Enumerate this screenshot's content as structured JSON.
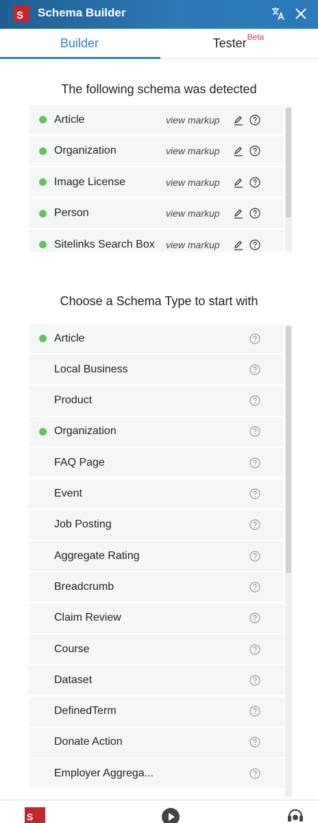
{
  "app": {
    "logo_letter": "S",
    "title": "Schema Builder"
  },
  "tabs": {
    "builder": "Builder",
    "tester": "Tester",
    "tester_badge": "Beta"
  },
  "detected": {
    "heading": "The following schema was detected",
    "items": [
      {
        "label": "Article",
        "action": "view markup",
        "active": true
      },
      {
        "label": "Organization",
        "action": "view markup",
        "active": true
      },
      {
        "label": "Image License",
        "action": "view markup",
        "active": true
      },
      {
        "label": "Person",
        "action": "view markup",
        "active": true
      },
      {
        "label": "Sitelinks Search Box",
        "action": "view markup",
        "active": true
      }
    ]
  },
  "types": {
    "heading": "Choose a Schema Type to start with",
    "items": [
      {
        "label": "Article",
        "active": true
      },
      {
        "label": "Local Business",
        "active": false
      },
      {
        "label": "Product",
        "active": false
      },
      {
        "label": "Organization",
        "active": true
      },
      {
        "label": "FAQ Page",
        "active": false
      },
      {
        "label": "Event",
        "active": false
      },
      {
        "label": "Job Posting",
        "active": false
      },
      {
        "label": "Aggregate Rating",
        "active": false
      },
      {
        "label": "Breadcrumb",
        "active": false
      },
      {
        "label": "Claim Review",
        "active": false
      },
      {
        "label": "Course",
        "active": false
      },
      {
        "label": "Dataset",
        "active": false
      },
      {
        "label": "DefinedTerm",
        "active": false
      },
      {
        "label": "Donate Action",
        "active": false
      },
      {
        "label": "Employer Aggrega...",
        "active": false
      }
    ]
  },
  "footer": {
    "logo_letter": "S"
  },
  "colors": {
    "header": "#2a72ad",
    "accent": "#2f80c1",
    "active_dot": "#62c35b",
    "badge": "#d23a3a",
    "logo": "#c4262e"
  },
  "icons": [
    "translate-icon",
    "close-icon",
    "edit-icon",
    "help-icon",
    "play-icon",
    "support-icon"
  ]
}
